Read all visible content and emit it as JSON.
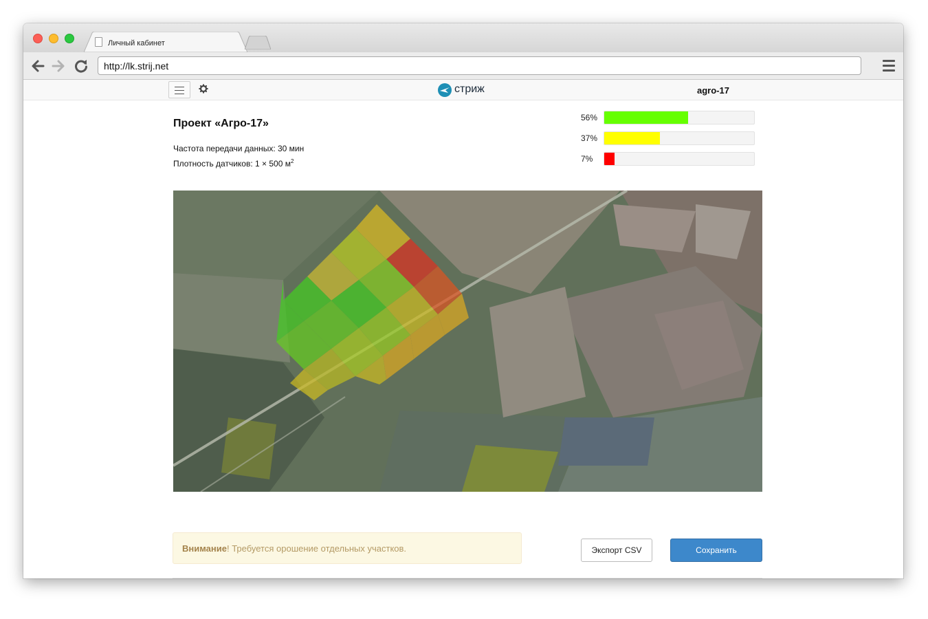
{
  "browser": {
    "tab_title": "Личный кабинет",
    "url": "http://lk.strij.net"
  },
  "header": {
    "logo_text": "стриж",
    "username": "agro-17"
  },
  "project": {
    "title": "Проект «Агро-17»",
    "frequency": "Частота передачи данных: 30 мин",
    "density_prefix": "Плотность датчиков: 1 × 500 м",
    "density_sup": "2"
  },
  "stats": [
    {
      "label": "56%",
      "value": 56,
      "color": "#66ff00"
    },
    {
      "label": "37%",
      "value": 37,
      "color": "#ffff00"
    },
    {
      "label": "7%",
      "value": 7,
      "color": "#ff0000"
    }
  ],
  "alert": {
    "strong": "Внимание",
    "text": "! Требуется орошение отдельных участков."
  },
  "buttons": {
    "export": "Экспорт CSV",
    "save": "Сохранить"
  },
  "map": {
    "zone_colors": {
      "good": "#44cc22",
      "warning": "#ddbb22",
      "critical": "#dd3322"
    }
  }
}
